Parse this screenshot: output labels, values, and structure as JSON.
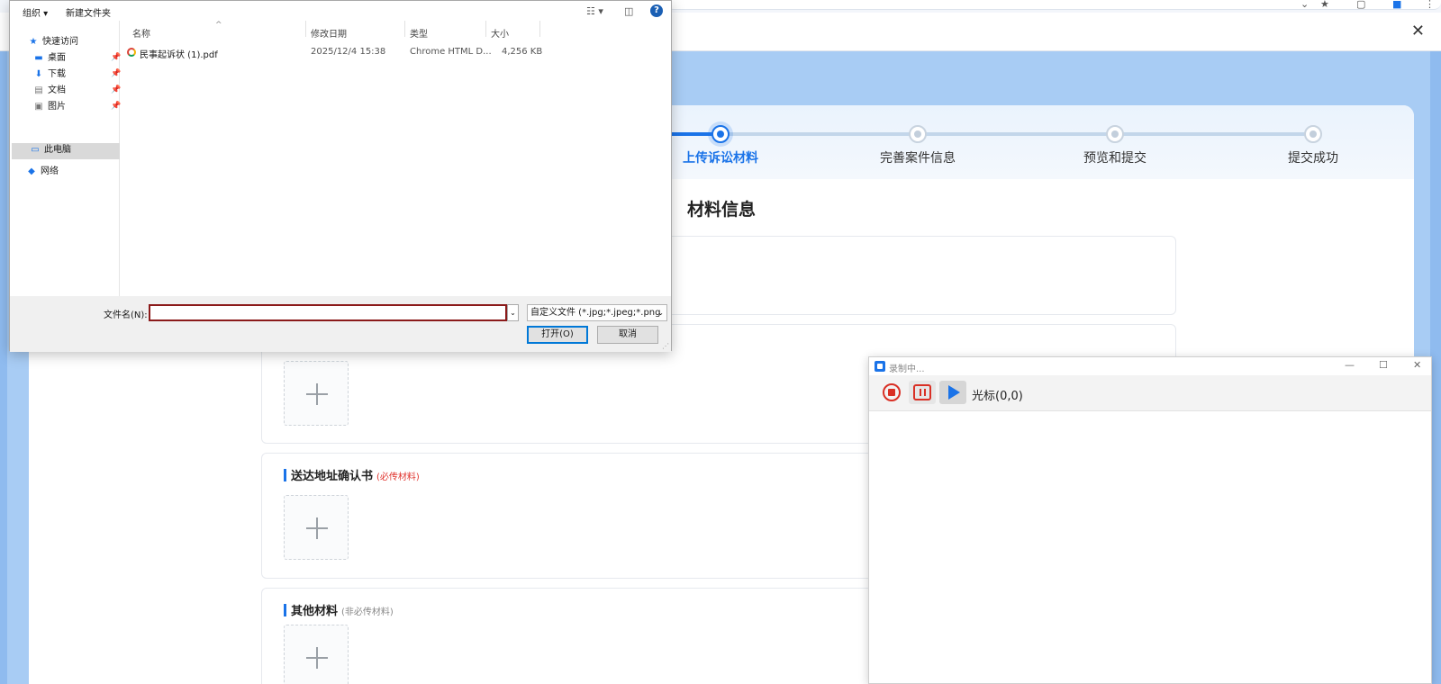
{
  "popup": {
    "close_icon": "close-icon"
  },
  "steps": [
    {
      "label": "上传诉讼材料",
      "active": true
    },
    {
      "label": "完善案件信息",
      "active": false
    },
    {
      "label": "预览和提交",
      "active": false
    },
    {
      "label": "提交成功",
      "active": false
    }
  ],
  "section_title": "材料信息",
  "panels": {
    "delivery": {
      "title": "送达地址确认书",
      "note": "(必传材料)"
    },
    "other": {
      "title": "其他材料",
      "note": "(非必传材料)"
    }
  },
  "file_dialog": {
    "toolbar": {
      "organize": "组织",
      "new_folder": "新建文件夹",
      "help": "?"
    },
    "nav": {
      "quick_access": "快速访问",
      "desktop": "桌面",
      "downloads": "下载",
      "documents": "文档",
      "pictures": "图片",
      "this_pc": "此电脑",
      "network": "网络"
    },
    "columns": {
      "name": "名称",
      "modified": "修改日期",
      "type": "类型",
      "size": "大小"
    },
    "files": [
      {
        "name": "民事起诉状 (1).pdf",
        "modified": "2025/12/4 15:38",
        "type": "Chrome HTML D...",
        "size": "4,256 KB"
      }
    ],
    "filename_label": "文件名(N):",
    "filename_value": "",
    "filter": "自定义文件 (*.jpg;*.jpeg;*.png",
    "open_button": "打开(O)",
    "cancel_button": "取消"
  },
  "recorder": {
    "title": "录制中...",
    "cursor_label": "光标(0,0)"
  }
}
